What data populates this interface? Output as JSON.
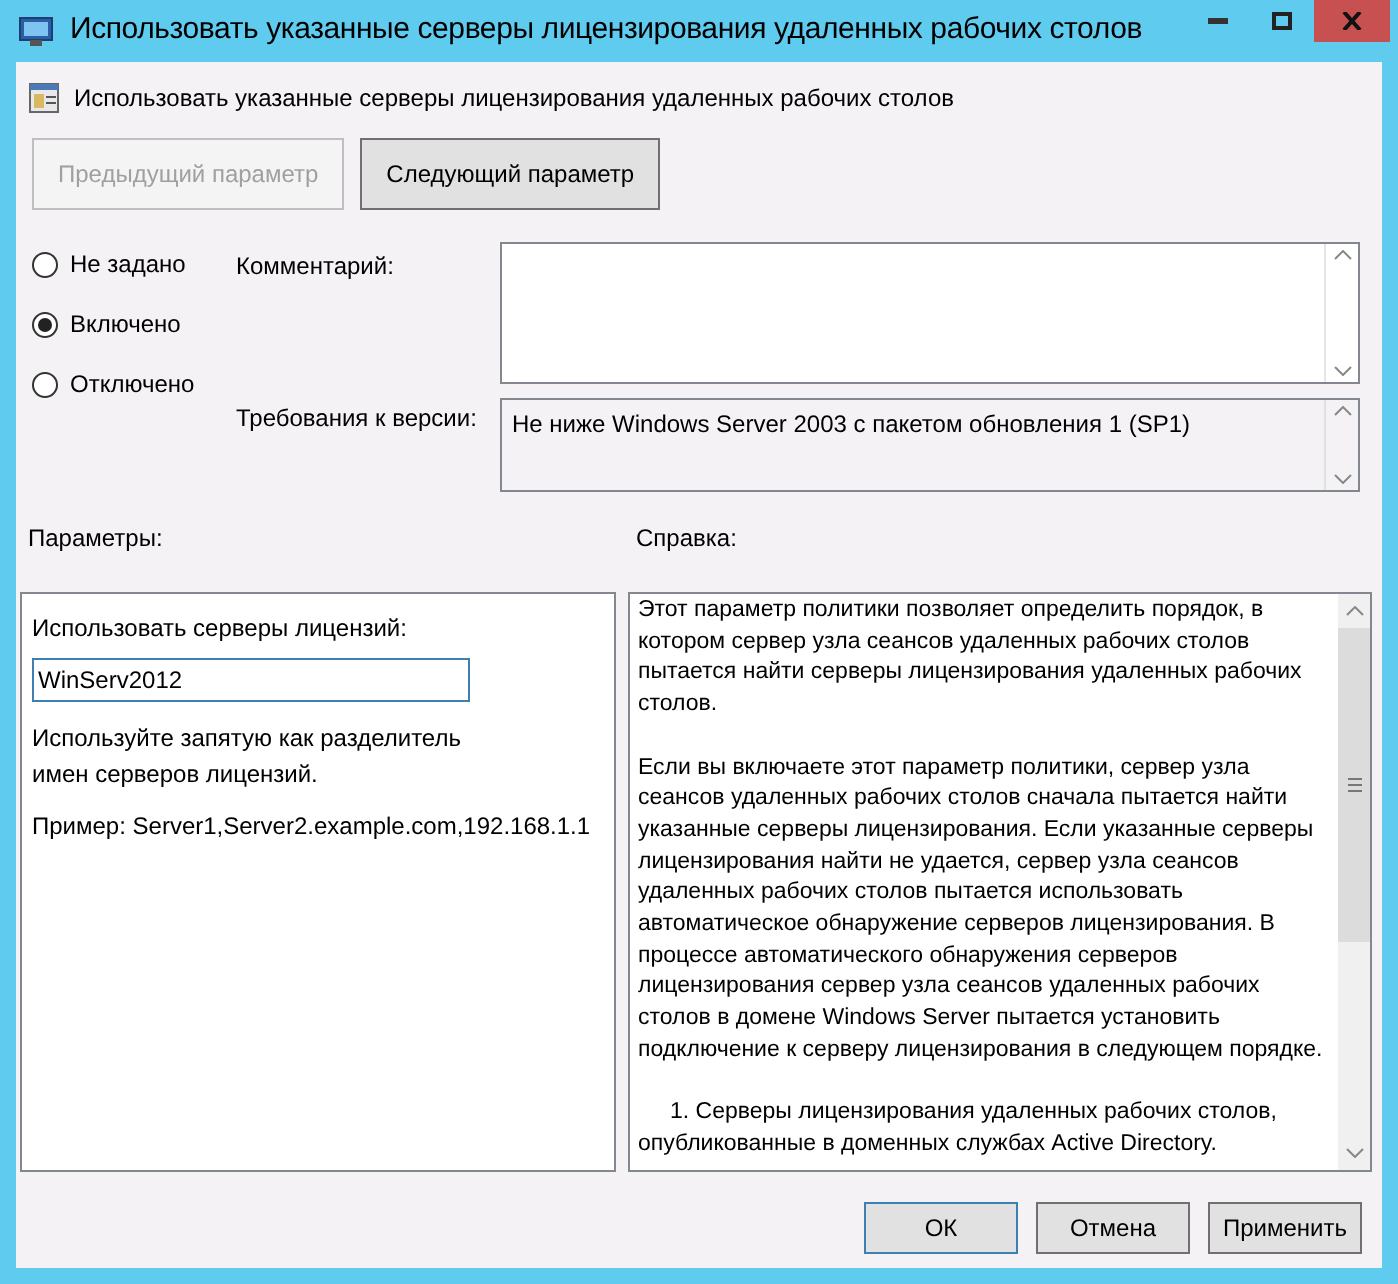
{
  "window": {
    "title": "Использовать указанные серверы лицензирования удаленных рабочих столов"
  },
  "header": {
    "title": "Использовать указанные серверы лицензирования удаленных рабочих столов"
  },
  "nav_buttons": [
    {
      "label": "Предыдущий параметр",
      "disabled": true
    },
    {
      "label": "Следующий параметр",
      "disabled": false
    }
  ],
  "state_options": [
    {
      "label": "Не задано",
      "selected": false
    },
    {
      "label": "Включено",
      "selected": true
    },
    {
      "label": "Отключено",
      "selected": false
    }
  ],
  "comment": {
    "label": "Комментарий:"
  },
  "requirements": {
    "label": "Требования к версии:",
    "value": "Не ниже Windows Server 2003 с пакетом обновления 1 (SP1)"
  },
  "options_label": "Параметры:",
  "help_label": "Справка:",
  "options": {
    "field_label": "Использовать серверы лицензий:",
    "value": "WinServ2012",
    "hint": "Используйте запятую как разделитель имен серверов лицензий.",
    "example": "Пример: Server1,Server2.example.com,192.168.1.1"
  },
  "help_paragraphs": [
    "Этот параметр политики позволяет определить порядок, в котором сервер узла сеансов удаленных рабочих столов пытается найти серверы лицензирования удаленных рабочих столов.",
    "Если вы включаете этот параметр политики, сервер узла сеансов удаленных рабочих столов сначала пытается найти указанные серверы лицензирования. Если указанные серверы лицензирования найти не удается, сервер узла сеансов удаленных рабочих столов пытается использовать автоматическое обнаружение серверов лицензирования. В процессе автоматического обнаружения серверов лицензирования сервер узла сеансов удаленных рабочих столов в домене Windows Server пытается установить подключение к серверу лицензирования в следующем порядке.",
    "1. Серверы лицензирования удаленных рабочих столов, опубликованные в доменных службах Active Directory."
  ],
  "buttons": [
    {
      "label": "ОК",
      "default": true
    },
    {
      "label": "Отмена",
      "default": false
    },
    {
      "label": "Применить",
      "default": false
    }
  ]
}
